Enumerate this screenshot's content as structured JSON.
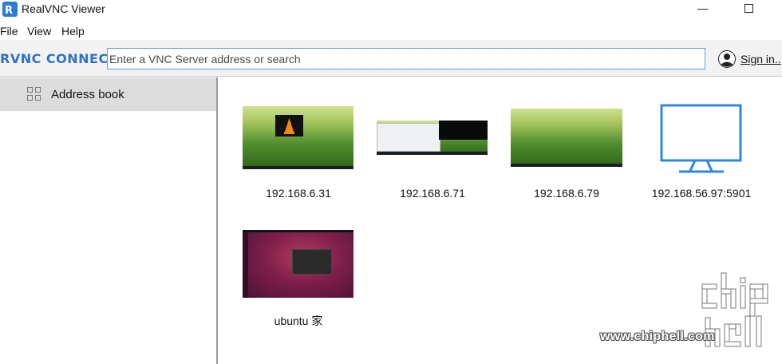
{
  "window": {
    "title": "RealVNC Viewer",
    "app_icon": "realvnc-logo-icon",
    "accent_color": "#2e7bd6"
  },
  "menu": {
    "items": [
      "File",
      "View",
      "Help"
    ]
  },
  "toolbar": {
    "brand": "RVNC CONNECT",
    "search_placeholder": "Enter a VNC Server address or search",
    "search_value": "",
    "signin_label": "Sign in..",
    "signin_icon": "user-avatar-icon"
  },
  "sidebar": {
    "items": [
      {
        "label": "Address book",
        "icon": "grid-icon",
        "selected": true
      }
    ]
  },
  "connections": [
    {
      "label": "192.168.6.31",
      "thumbnail": "desktop-grass-vlc"
    },
    {
      "label": "192.168.6.71",
      "thumbnail": "desktop-grass-windows"
    },
    {
      "label": "192.168.6.79",
      "thumbnail": "desktop-grass"
    },
    {
      "label": "192.168.56.97:5901",
      "thumbnail": "monitor-icon"
    },
    {
      "label": "ubuntu 家",
      "thumbnail": "desktop-ubuntu-terminal"
    }
  ],
  "watermark": {
    "text": "www.chiphell.com",
    "logo": "chiphell-logo"
  }
}
